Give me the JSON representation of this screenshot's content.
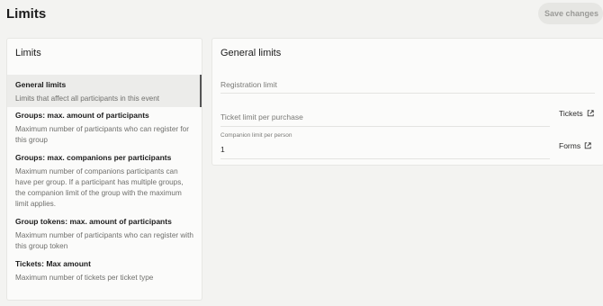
{
  "header": {
    "title": "Limits",
    "save_label": "Save changes"
  },
  "sidebar": {
    "title": "Limits",
    "items": [
      {
        "title": "General limits",
        "desc": "Limits that affect all participants in this event"
      },
      {
        "title": "Groups: max. amount of participants",
        "desc": "Maximum number of participants who can register for this group"
      },
      {
        "title": "Groups: max. companions per participants",
        "desc": "Maximum number of companions participants can have per group. If a participant has multiple groups, the companion limit of the group with the maximum limit applies."
      },
      {
        "title": "Group tokens: max. amount of participants",
        "desc": "Maximum number of participants who can register with this group token"
      },
      {
        "title": "Tickets: Max amount",
        "desc": "Maximum number of tickets per ticket type"
      }
    ]
  },
  "main": {
    "title": "General limits",
    "registration_limit_placeholder": "Registration limit",
    "ticket_limit_placeholder": "Ticket limit per purchase",
    "companion_label": "Companion limit per person",
    "companion_value": "1",
    "tickets_link": "Tickets",
    "forms_link": "Forms"
  },
  "icons": {
    "external": "external-link-icon"
  }
}
